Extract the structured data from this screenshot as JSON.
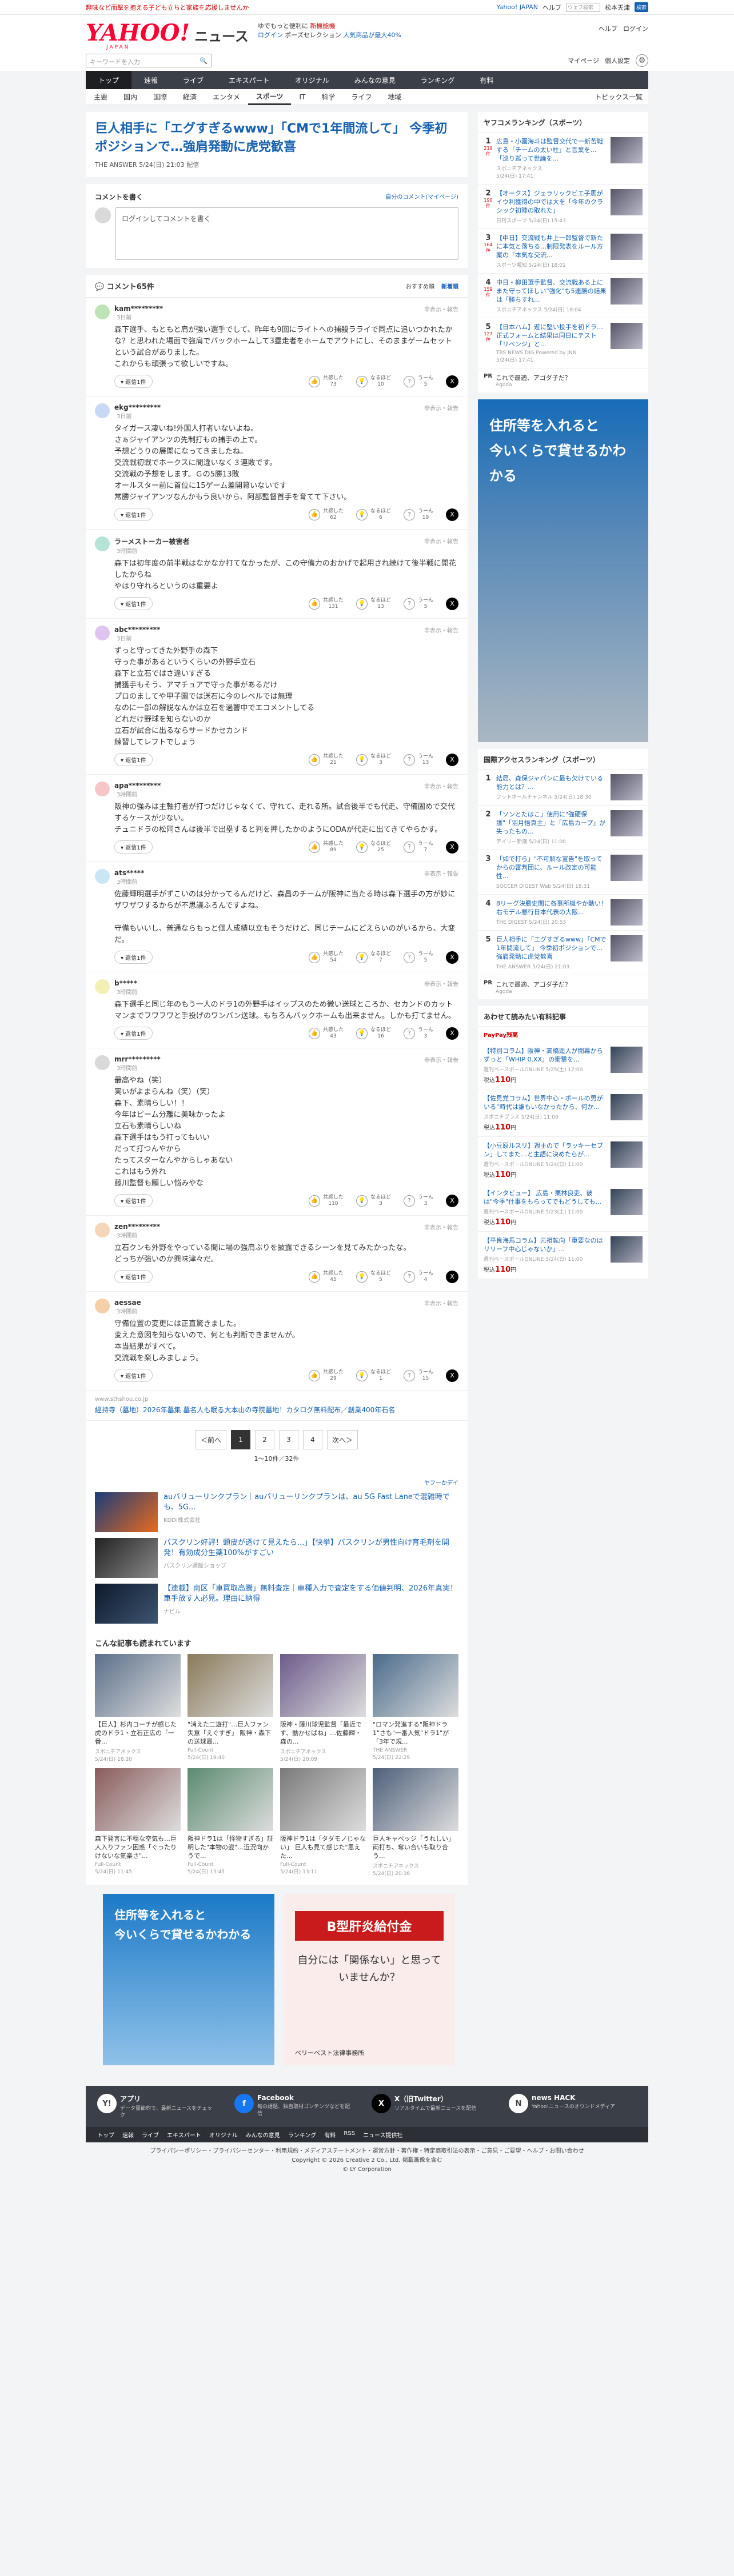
{
  "topbar": {
    "promo": "趣味など而撃を抱える子ども立ちと家族を応援しませんか",
    "links": [
      "Yahoo! JAPAN",
      "ヘルプ"
    ],
    "search_placeholder": "ウェブ検索",
    "area": "松本天津",
    "search_btn": "検索"
  },
  "header": {
    "logo": "YAHOO!",
    "logo_sub": "JAPAN",
    "section": "ニュース",
    "promo_line1": "ゆでもっと便利に",
    "promo_line1b": "新機能機",
    "promo_line2a": "ログイン",
    "promo_line2b": "ポーズセレクション",
    "promo_line2c": "人気商品が最大40%",
    "links": [
      "ヘルプ",
      "ログイン"
    ]
  },
  "search": {
    "placeholder": "キーワードを入力",
    "my_page": "マイページ",
    "login_label": "個人設定",
    "gear": "gear-icon"
  },
  "main_nav": [
    {
      "label": "トップ",
      "active": true
    },
    {
      "label": "速報"
    },
    {
      "label": "ライブ"
    },
    {
      "label": "エキスパート"
    },
    {
      "label": "オリジナル"
    },
    {
      "label": "みんなの意見"
    },
    {
      "label": "ランキング"
    },
    {
      "label": "有料"
    }
  ],
  "sub_nav": {
    "items": [
      {
        "label": "主要"
      },
      {
        "label": "国内"
      },
      {
        "label": "国際"
      },
      {
        "label": "経済"
      },
      {
        "label": "エンタメ"
      },
      {
        "label": "スポーツ",
        "active": true
      },
      {
        "label": "IT"
      },
      {
        "label": "科学"
      },
      {
        "label": "ライフ"
      },
      {
        "label": "地域"
      }
    ],
    "topics": "トピックス一覧"
  },
  "article": {
    "title": "巨人相手に「エグすぎるwww」「CMで1年間流して」 今季初ポジションで…強肩発動に虎党歓喜",
    "source": "THE ANSWER",
    "date": "5/24(日) 21:03",
    "link": "配信"
  },
  "comment_form": {
    "title": "コメントを書く",
    "my_comments": "自分のコメント(マイページ)",
    "placeholder": "ログインしてコメントを書く"
  },
  "comment_list": {
    "title": "コメント65件",
    "sort_recommend": "おすすめ順",
    "sort_new": "新着順"
  },
  "comments": [
    {
      "user": "kam*********",
      "time": "3日前",
      "report": "非表示・報告",
      "body": "森下選手、もともと肩が強い選手でして、昨年も9回にライトへの捕殺ラライで同点に追いつかれたかな？と思われた場面で強肩でバックホームして3塁走者をホームでアウトにし、そのままゲームセットという試合がありました。\nこれからも頑張って欲しいですね。",
      "empathy": "共感した\n73",
      "think": "なるほど\n10",
      "hmm": "うーん\n5",
      "color": "#bde3b6"
    },
    {
      "user": "ekg*********",
      "time": "3日前",
      "report": "非表示・報告",
      "body": "タイガース凄いね!外国人打者いないよね。\nさぁジャイアンツの先制打もの捕手の上で。\n予想どうりの展開になってきましたね。\n交流戦初戦でホークスに間違いなく３連敗です。\n交流戦の予想をします。Ｇの5勝13敗\nオールスター前に首位に15ゲーム差開幕いないです\n常勝ジャイアンツなんかもう良いから、阿部監督首手を育てて下さい。",
      "empathy": "共感した\n62",
      "think": "なるほど\n6",
      "hmm": "うーん\n19",
      "color": "#c9d9f5"
    },
    {
      "user": "ラーメストーカー被害者",
      "time": "3時間前",
      "report": "非表示・報告",
      "body": "森下は初年度の前半戦はなかなか打てなかったが、この守備力のおかげで起用され続けて後半戦に開花したからね\nやはり守れるというのは重要よ",
      "empathy": "共感した\n131",
      "think": "なるほど\n13",
      "hmm": "うーん\n5",
      "color": "#b6e3d8"
    },
    {
      "user": "abc*********",
      "time": "3日前",
      "report": "非表示・報告",
      "body": "ずっと守ってきた外野手の森下\n守った事があるというくらいの外野手立石\n森下と立石ではさ違いすぎる\n捕獲手もそう、アマチュアで守った事があるだけ\nプロのましてや甲子園では送石に今のレベルでは無理\nなのに一部の解説なんかは立石を過響中でエコメントしてる\nどれだけ野球を知らないのか\n立石が試合に出るならサードかセカンド\n練習してレフトでしょう",
      "empathy": "共感した\n21",
      "think": "なるほど\n3",
      "hmm": "うーん\n13",
      "color": "#e0c4f0"
    },
    {
      "user": "apa*********",
      "time": "3時間前",
      "report": "非表示・報告",
      "body": "阪神の強みは主軸打者が打つだけじゃなくて、守れて、走れる所。試合後半でも代走、守備固めで交代するケースが少ない。\nチュニドラの松岡さんは後半で出塁すると判を押したかのようにODAが代走に出てきてやらかす。",
      "empathy": "共感した\n89",
      "think": "なるほど\n25",
      "hmm": "うーん\n7",
      "color": "#f5c7c7"
    },
    {
      "user": "ats*****",
      "time": "3時間前",
      "report": "非表示・報告",
      "body": "佐藤輝明選手がずこいのは分かってるんだけど、森昌のチームが阪神に当たる時は森下選手の方が妙にザワザワするからが不思議ふろんですよね。\n\n守備もいいし、普通ならもっと個人成績以立もそうだけど、同じチームにどえらいのがいるから、大変だ。",
      "empathy": "共感した\n54",
      "think": "なるほど\n7",
      "hmm": "うーん\n5",
      "color": "#c9e6f5"
    },
    {
      "user": "b*****",
      "time": "3時間前",
      "report": "非表示・報告",
      "body": "森下選手と同じ年のもう一人のドラ1の外野手はイップスのため微い送球ところか、セカンドのカットマンまでフワフワと手投げのワンバン送球。もちろんバックホームも出来ません。しかも打てません。",
      "empathy": "共感した\n43",
      "think": "なるほど\n16",
      "hmm": "うーん\n3",
      "color": "#f3f0b5"
    },
    {
      "user": "mrr*********",
      "time": "3時間前",
      "report": "非表示・報告",
      "body": "最高やね（笑）\n実いがよまらんね（笑）（笑）\n森下、素晴らしい！！\n今年はピーム分離に美味かったよ\n立石も素晴らしいね\n森下選手はもう打ってもいい\nだって打つんやから\nたってスターなんやからしゃあない\nこれはもう外れ\n藤川監督も願しい悩みやな",
      "empathy": "共感した\n110",
      "think": "なるほど\n3",
      "hmm": "うーん\n3",
      "color": "#d9d9d9"
    },
    {
      "user": "zen*********",
      "time": "3時間前",
      "report": "非表示・報告",
      "body": "立石クンも外野をやっている間に場の強肩ぶりを披露できるシーンを見てみたかったな。\nどっちが強いのか興味津々だ。",
      "empathy": "共感した\n45",
      "think": "なるほど\n5",
      "hmm": "うーん\n4",
      "color": "#f5d6b8"
    },
    {
      "user": "aessae",
      "time": "3時間前",
      "report": "非表示・報告",
      "body": "守備位置の変更には正直驚きました。\n変えた意図を知らないので、何とも判断できませんが。\n本当結果がすべて。\n交流戦を楽しみましょう。",
      "empathy": "共感した\n29",
      "think": "なるほど\n1",
      "hmm": "うーん\n15",
      "color": "#f5cfa8"
    }
  ],
  "inline_ad": {
    "host": "www.sthshou.co.jp",
    "text": "經持寺（墓地）2026年墓集 墓名人も眠る大本山の寺院墓地！カタログ無料配布／創業400年石名"
  },
  "pager": {
    "prev": "＜前へ",
    "pages": [
      "1",
      "2",
      "3",
      "4"
    ],
    "next": "次へ＞",
    "info": "1〜10件／32件"
  },
  "ads": {
    "label": "ヤフーかデイ",
    "items": [
      {
        "t": "auバリューリンクプラン｜auバリューリンクプランは、au 5G Fast Laneで混雑時でも、5G...",
        "s": "KDDI株式会社"
      },
      {
        "t": "パスクリン好評！頭皮が透けて見えたら...」【快挙】パスクリンが男性向け育毛剤を開発！有効成分生薬100%がすごい",
        "s": "パスクリン通販ショップ"
      },
      {
        "t": "【連載】南区「車買取高騰」無料査定｜車種入力で査定をする価値判明、2026年真実！車手放す人必見。理由に納得",
        "s": "ナビル"
      }
    ]
  },
  "recommend": {
    "title": "こんな記事も読まれています",
    "items": [
      {
        "t": "【巨人】杉内コーチが感じた虎のドラ1・立石正広の「一番...",
        "s": "スポニチアネックス\n5/24(日) 18:20"
      },
      {
        "t": "\"消えた二遊打\"…巨人ファン失意「えぐすぎ」 阪神・森下の送球最...",
        "s": "Full-Count\n5/24(日) 19:40"
      },
      {
        "t": "阪神・藤川球児監督「最近です、動かせばね」…佐藤輝・森の...",
        "s": "スポニチアネックス\n5/24(日) 20:09"
      },
      {
        "t": "\"ロマン発進する\"阪神ドラ1\"さも\"一番人気\"ドラ1\"が「3年で規...",
        "s": "THE ANSWER\n5/24(日) 22:29"
      },
      {
        "t": "森下発言に不穏な空気も…巨人入りファン困惑「ぐったりけないな気楽さ\"...",
        "s": "Full-Count\n5/24(日) 11:45"
      },
      {
        "t": "阪神ドラ1は「怪物すぎる」証明した\"本物の姿\"…近況向かうで...",
        "s": "Full-Count\n5/24(日) 13:45"
      },
      {
        "t": "阪神ドラ1は「タダモノじゃない」 巨人も見て感じた\"思えた…",
        "s": "Full-Count\n5/24(日) 13:11"
      },
      {
        "t": "巨人キャベッジ「うれしい」 両打ち、奪い合いも取り合う...",
        "s": "スポニチアネックス\n5/24(日) 20:36"
      }
    ]
  },
  "big_ads": [
    {
      "l1": "住所等を入れると",
      "l2": "今いくらで貸せるかわかる"
    },
    {
      "l1": "B型肝炎給付金",
      "l2": "自分には「関係ない」と思っていませんか？",
      "foot": "ベリーベスト法律事務所"
    }
  ],
  "side_ranking": {
    "title": "ヤフコメランキング（スポーツ）",
    "items": [
      {
        "num": "1",
        "cnt": "219件",
        "t": "広島・小園海斗は監督交代で一新苦戦する「チームの太い柱」と言葉を…「巡り巡って世論を...",
        "s": "スポニチアネックス\n5/24(日) 17:41"
      },
      {
        "num": "2",
        "cnt": "190件",
        "t": "【オークス】ジェラリックビエ子馬がイウ利獲得の中では大を「今年のクラシック初陣の取れた」",
        "s": "日刊スポーツ 5/24(日) 15:43"
      },
      {
        "num": "3",
        "cnt": "164件",
        "t": "【中日】交流戦も井上一郎監督で新たに本気と落ちる…制限発表をルール方案の「本気な交流...",
        "s": "スポーツ報知 5/24(日) 18:01"
      },
      {
        "num": "4",
        "cnt": "159件",
        "t": "中日・柳田選手監督、交流戦ある上にまた守ってほしい\"強化\"も5連勝の結果は「勝ちすれ...",
        "s": "スポニチアネックス 5/24(日) 18:04"
      },
      {
        "num": "5",
        "cnt": "127件",
        "t": "【日本ハム】遊に堅い投手を初ドラ…正式フォームと結果は同日にテスト「リベンジ」と...",
        "s": "TBS NEWS DIG Powered by JNN\n5/24(日) 17:41"
      }
    ],
    "pr": {
      "lbl": "PR",
      "t": "これで最適、アゴダ子だ？",
      "s": "Agoda"
    }
  },
  "side_access": {
    "title": "国際アクセスランキング（スポーツ）",
    "items": [
      {
        "num": "1",
        "t": "結局、森保ジャパンに最も欠けている能力とは？...",
        "s": "フットボールチャンネル 5/24(日) 18:30"
      },
      {
        "num": "2",
        "t": "「ソンとたはこ」使用に\"強硬保護\"「羽月悟真主」と「広島カープ」が失ったもの...",
        "s": "デイリー新潮 5/24(日) 11:00"
      },
      {
        "num": "3",
        "t": "「如で打ら」\"不可解な宣告\"を取ってからの審判団に、ルール改定の可能性...",
        "s": "SOCCER DIGEST Web 5/24(日) 18:31"
      },
      {
        "num": "4",
        "t": "8リーグ決勝史間に各事所機やか動い！ 右モデル悪行日本代表の大阪...",
        "s": "THE DIGEST 5/24(日) 20:53"
      },
      {
        "num": "5",
        "t": "巨人相手に「エグすぎるwww」「CMで1年間流して」 今季初ポジションで…強肩発動に虎党歓喜",
        "s": "THE ANSWER 5/24(日) 21:03"
      }
    ],
    "pr": {
      "lbl": "PR",
      "t": "これで最適、アゴダ子だ？",
      "s": "Agoda"
    }
  },
  "side_paid": {
    "title": "あわせて読みたい有料記事",
    "badge": "PayPay残高",
    "items": [
      {
        "t": "【特別コラム】阪神・高橋遥人が開幕からずっと「WHIP 0.XX」の衝撃を...",
        "s": "週刊ベースボールONLINE 5/25(土) 17:00",
        "price": "110"
      },
      {
        "t": "【佐見党コラム】世界中心・ボールの男がいる“時代は誰もいなかったから、何か...",
        "s": "スポニチプラス 5/24(日) 11:00",
        "price": "110"
      },
      {
        "t": "【小豆原ルスリ】週主ので「ラッキーセブン」してまた…と主語に決めたらが...",
        "s": "週刊ベースボールONLINE 5/24(日) 11:00",
        "price": "110"
      },
      {
        "t": "【インタビュー】 広島・栗林良吏、彼は\"今季\"仕事をもらってでもどうしても...",
        "s": "週刊ベースボールONLINE 5/23(土) 11:00",
        "price": "110"
      },
      {
        "t": "【平良海馬コラム】元祖転向「重要なのはリリーフ中心じゃないか」...",
        "s": "週刊ベースボールONLINE 5/24(日) 11:00",
        "price": "110"
      }
    ]
  },
  "footer": {
    "apps": [
      {
        "n": "アプリ",
        "d": "データ量節約で、最新ニュースをチェック"
      },
      {
        "n": "Facebook",
        "d": "旬の話題、独自取材ゴンテンツなどを配信"
      },
      {
        "n": "X（旧Twitter）",
        "d": "リアルタイムで最新ニュースを配信"
      },
      {
        "n": "news HACK",
        "d": "Yahoo!ニュースのオウンドメディア"
      }
    ],
    "nav": [
      "トップ",
      "速報",
      "ライブ",
      "エキスパート",
      "オリジナル",
      "みんなの意見",
      "ランキング",
      "有料",
      "RSS",
      "ニュース提供社"
    ],
    "legal1": "プライバシーポリシー・プライバシーセンター・利用規約・メディアステートメント・運営方針・著作権・特定商取引法の表示・ご意見・ご要望・ヘルプ・お問い合わせ",
    "legal2": "Copyright © 2026 Creative 2 Co., Ltd. 掲載画像を含む",
    "legal3": "© LY Corporation"
  }
}
